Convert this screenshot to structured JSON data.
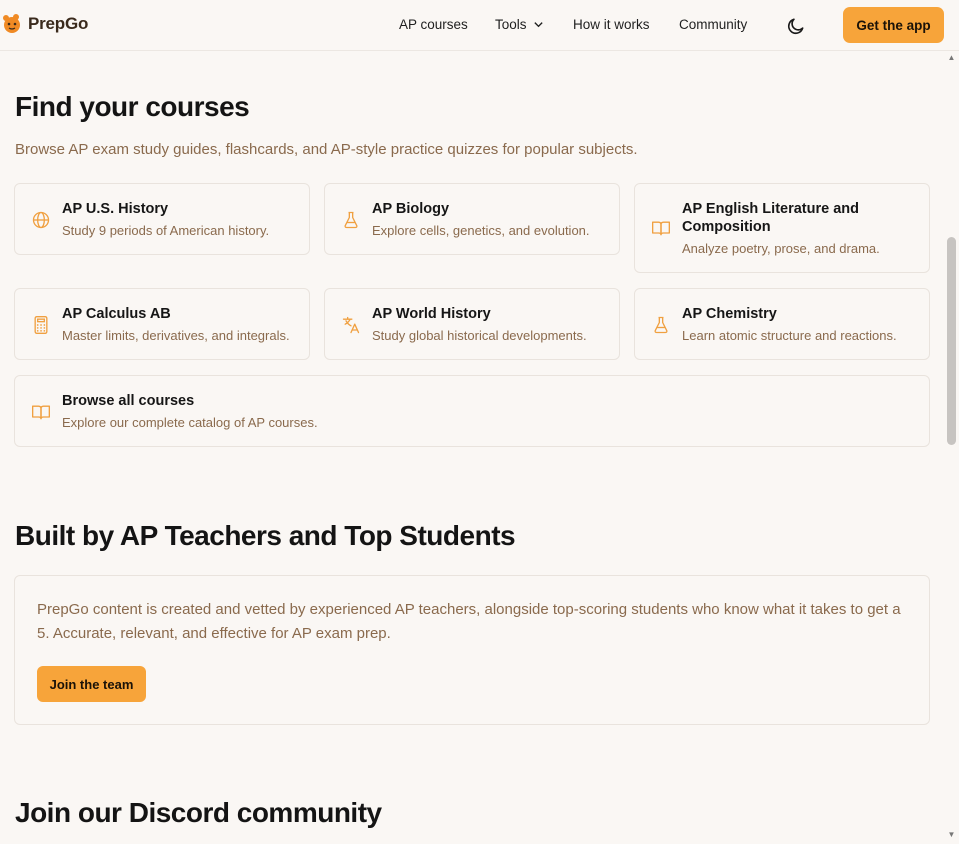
{
  "header": {
    "logo_text": "PrepGo",
    "nav": [
      {
        "label": "AP courses"
      },
      {
        "label": "Tools",
        "has_dropdown": true
      },
      {
        "label": "How it works"
      },
      {
        "label": "Community"
      }
    ],
    "theme_icon": "moon-icon",
    "cta_label": "Get the app"
  },
  "courses_section": {
    "title": "Find your courses",
    "subtitle": "Browse AP exam study guides, flashcards, and AP-style practice quizzes for popular subjects.",
    "cards": [
      {
        "title": "AP U.S. History",
        "desc": "Study 9 periods of American history.",
        "icon": "globe-icon"
      },
      {
        "title": "AP Biology",
        "desc": "Explore cells, genetics, and evolution.",
        "icon": "flask-icon"
      },
      {
        "title": "AP English Literature and Composition",
        "desc": "Analyze poetry, prose, and drama.",
        "icon": "book-open-icon"
      },
      {
        "title": "AP Calculus AB",
        "desc": "Master limits, derivatives, and integrals.",
        "icon": "calculator-icon"
      },
      {
        "title": "AP World History",
        "desc": "Study global historical developments.",
        "icon": "translate-icon"
      },
      {
        "title": "AP Chemistry",
        "desc": "Learn atomic structure and reactions.",
        "icon": "flask-icon"
      },
      {
        "title": "Browse all courses",
        "desc": "Explore our complete catalog of AP courses.",
        "icon": "book-open-icon"
      }
    ]
  },
  "team_section": {
    "title": "Built by AP Teachers and Top Students",
    "body": "PrepGo content is created and vetted by experienced AP teachers, alongside top-scoring students who know what it takes to get a 5. Accurate, relevant, and effective for AP exam prep.",
    "button_label": "Join the team"
  },
  "discord_section": {
    "title": "Join our Discord community"
  },
  "colors": {
    "accent": "#f7a43a",
    "background": "#faf7f4",
    "muted_text": "#8a6a4d",
    "icon": "#f0a040"
  }
}
